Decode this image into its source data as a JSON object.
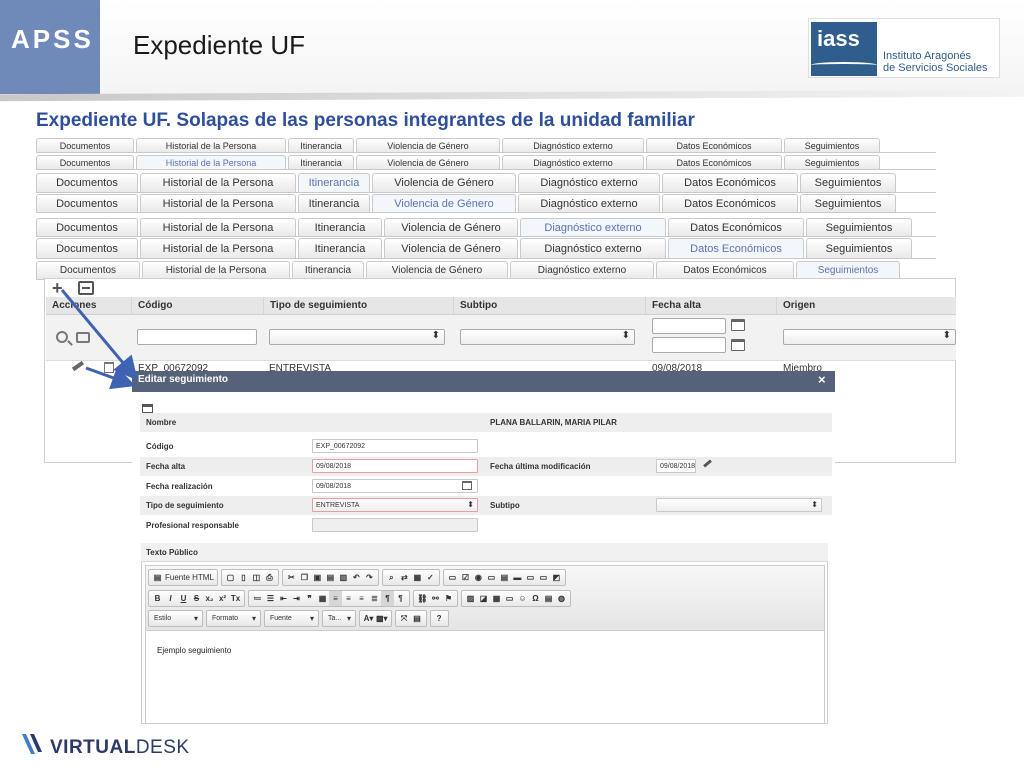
{
  "header": {
    "apss": "APSS",
    "title": "Expediente UF",
    "iass_mark": "iass",
    "iass_name_1": "Instituto Aragonés",
    "iass_name_2": "de Servicios Sociales",
    "accent": "#6f89b8"
  },
  "subtitle": "Expediente UF. Solapas de las personas integrantes de la unidad familiar",
  "tabs": [
    "Documentos",
    "Historial de la Persona",
    "Itinerancia",
    "Violencia de Género",
    "Diagnóstico externo",
    "Datos Económicos",
    "Seguimientos"
  ],
  "grid": {
    "headers": [
      "Acciones",
      "Código",
      "Tipo de seguimiento",
      "Subtipo",
      "Fecha alta",
      "Origen"
    ],
    "row": {
      "codigo": "EXP_00672092",
      "tipo": "ENTREVISTA",
      "fecha": "09/08/2018",
      "origen": "Miembro"
    }
  },
  "modal": {
    "title": "Editar seguimiento",
    "close": "×",
    "nombre_label": "Nombre",
    "nombre_value": "PLANA BALLARIN, MARIA PILAR",
    "codigo_label": "Código",
    "codigo_value": "EXP_00672092",
    "fecha_alta_label": "Fecha alta",
    "fecha_alta_value": "09/08/2018",
    "fecha_mod_label": "Fecha última modificación",
    "fecha_mod_value": "09/08/2018",
    "fecha_real_label": "Fecha realización",
    "fecha_real_value": "09/08/2018",
    "tipo_label": "Tipo de seguimiento",
    "tipo_value": "ENTREVISTA",
    "subtipo_label": "Subtipo",
    "profesional_label": "Profesional responsable"
  },
  "editor": {
    "label": "Texto Público",
    "source_button": "Fuente HTML",
    "row2": [
      "B",
      "I",
      "U",
      "S",
      "x₂",
      "x²",
      "Tx"
    ],
    "dd_estilo": "Estilo",
    "dd_formato": "Formato",
    "dd_fuente": "Fuente",
    "dd_tamano": "Ta...",
    "help": "?",
    "content": "Ejemplo seguimiento"
  },
  "footer": {
    "brand_a": "VIRTUAL",
    "brand_b": "DESK"
  }
}
